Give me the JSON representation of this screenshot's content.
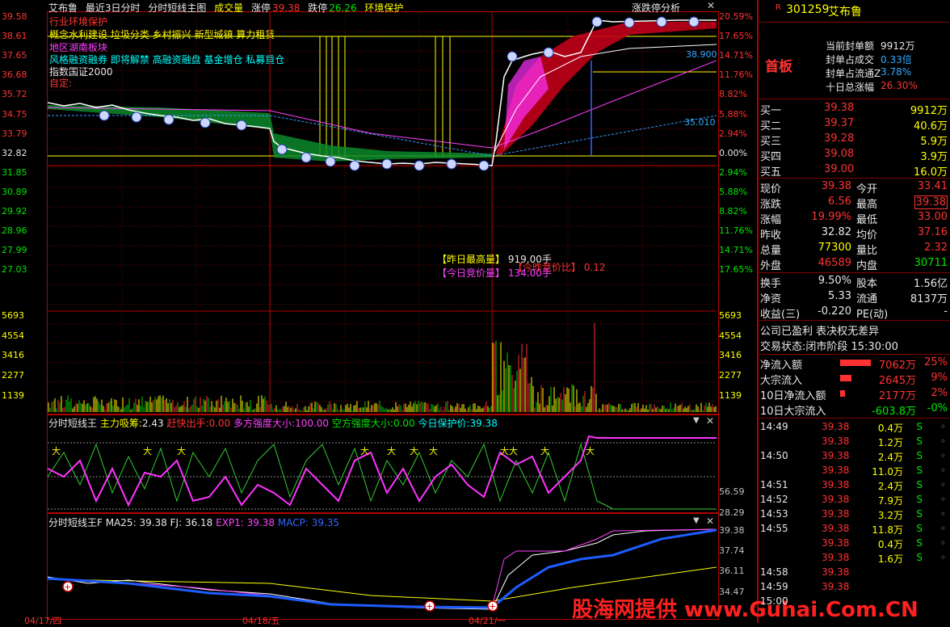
{
  "header": {
    "stock_name": "艾布鲁",
    "mode": "最近3日分时",
    "indicator": "分时短线主图",
    "volume_label": "成交量",
    "limit_up_label": "涨停",
    "limit_up_value": "39.38",
    "limit_down_label": "跌停",
    "limit_down_value": "26.26",
    "protect_label": "环境保护",
    "analysis_button": "涨跌停分析"
  },
  "concepts": {
    "line1": "行业环境保护",
    "line2": "概念水利建设 垃圾分类 乡村振兴 新型城镇 算力租赁",
    "line3": "地区湖南板块",
    "line4": "风格融资融券 即将解禁 高融资融盘 基金增仓 私募重仓",
    "line5": "指数国证2000",
    "line6": "自定:"
  },
  "price_axis_left": [
    "39.58",
    "38.61",
    "37.65",
    "36.68",
    "35.72",
    "34.75",
    "33.79",
    "32.82",
    "31.85",
    "30.89",
    "29.92",
    "28.96",
    "27.99",
    "27.03"
  ],
  "price_axis_right": [
    "20.59%",
    "17.65%",
    "14.71%",
    "11.76%",
    "8.82%",
    "5.88%",
    "2.94%",
    "0.00%",
    "2.94%",
    "5.88%",
    "8.82%",
    "11.76%",
    "14.71%",
    "17.65%"
  ],
  "volume_axis": [
    "5693",
    "4554",
    "3416",
    "2277",
    "1139"
  ],
  "chart_labels": {
    "avg_line_label": "35.010",
    "level_label": "38.900",
    "yest_high_vol_label": "【昨日最高量】",
    "yest_high_vol_value": "919.00手",
    "today_auction_label": "【今日竞价量】",
    "today_auction_value": "134.00手",
    "auction_ratio_label": "【今昨竞价比】",
    "auction_ratio_value": "0.12"
  },
  "panel2": {
    "title": "分时短线王",
    "main_label": "主力吸筹:",
    "main_value": "2.43",
    "exit_label": "赶快出手:",
    "exit_value": "0.00",
    "bull_label": "多方强度大小:",
    "bull_value": "100.00",
    "bear_label": "空方强度大小:",
    "bear_value": "0.00",
    "protect_label": "今日保护价:",
    "protect_value": "39.38",
    "axis": [
      "56.59",
      "28.29"
    ]
  },
  "panel3": {
    "title": "分时短线王F",
    "ma_label": "MA25:",
    "ma_value": "39.38",
    "fj_label": "FJ:",
    "fj_value": "36.18",
    "exp_label": "EXP1:",
    "exp_value": "39.38",
    "macp_label": "MACP:",
    "macp_value": "39.35",
    "axis": [
      "39.38",
      "37.74",
      "36.11",
      "34.47"
    ]
  },
  "dates": [
    "04/17/四",
    "04/18/五",
    "04/21/一"
  ],
  "watermark": "股海网提供 www.Guhai.Com.CN",
  "right": {
    "code": "301259",
    "name": "艾布鲁",
    "badge": "R",
    "board": "首板",
    "seal_rows": [
      {
        "label": "当前封单额",
        "value": "9912万"
      },
      {
        "label": "封单占成交",
        "value": "0.33倍"
      },
      {
        "label": "封单占流通Z",
        "value": "3.78%"
      },
      {
        "label": "十日总涨幅",
        "value": "26.30%"
      }
    ],
    "bids": [
      {
        "label": "买一",
        "price": "39.38",
        "vol": "9912万"
      },
      {
        "label": "买二",
        "price": "39.37",
        "vol": "40.6万"
      },
      {
        "label": "买三",
        "price": "39.28",
        "vol": "5.9万"
      },
      {
        "label": "买四",
        "price": "39.08",
        "vol": "3.9万"
      },
      {
        "label": "买五",
        "price": "39.00",
        "vol": "16.0万"
      }
    ],
    "quote": [
      {
        "l1": "现价",
        "v1": "39.38",
        "l2": "今开",
        "v2": "33.41"
      },
      {
        "l1": "涨跌",
        "v1": "6.56",
        "l2": "最高",
        "v2": "39.38"
      },
      {
        "l1": "涨幅",
        "v1": "19.99%",
        "l2": "最低",
        "v2": "33.00"
      },
      {
        "l1": "昨收",
        "v1": "32.82",
        "l2": "均价",
        "v2": "37.16"
      },
      {
        "l1": "总量",
        "v1": "77300",
        "l2": "量比",
        "v2": "2.32"
      },
      {
        "l1": "外盘",
        "v1": "46589",
        "l2": "内盘",
        "v2": "30711"
      }
    ],
    "fin": [
      {
        "l1": "换手",
        "v1": "9.50%",
        "l2": "股本",
        "v2": "1.56亿"
      },
      {
        "l1": "净资",
        "v1": "5.33",
        "l2": "流通",
        "v2": "8137万"
      },
      {
        "l1": "收益(三)",
        "v1": "-0.220",
        "l2": "PE(动)",
        "v2": "-"
      }
    ],
    "notice": "公司已盈利 表决权无差异",
    "trade_status": "交易状态:闭市阶段 15:30:00",
    "flows": [
      {
        "label": "净流入额",
        "value": "7062万",
        "pct": "25%"
      },
      {
        "label": "大宗流入",
        "value": "2645万",
        "pct": "9%"
      },
      {
        "label": "10日净流入额",
        "value": "2177万",
        "pct": "2%"
      },
      {
        "label": "10日大宗流入",
        "value": "-603.8万",
        "pct": "-0%"
      }
    ],
    "ticks": [
      {
        "time": "14:49",
        "price": "39.38",
        "vol": "0.4万",
        "side": "S"
      },
      {
        "time": "",
        "price": "39.38",
        "vol": "1.2万",
        "side": "S"
      },
      {
        "time": "14:50",
        "price": "39.38",
        "vol": "2.4万",
        "side": "S"
      },
      {
        "time": "",
        "price": "39.38",
        "vol": "11.0万",
        "side": "S"
      },
      {
        "time": "14:51",
        "price": "39.38",
        "vol": "2.4万",
        "side": "S"
      },
      {
        "time": "14:52",
        "price": "39.38",
        "vol": "7.9万",
        "side": "S"
      },
      {
        "time": "14:53",
        "price": "39.38",
        "vol": "3.2万",
        "side": "S"
      },
      {
        "time": "14:55",
        "price": "39.38",
        "vol": "11.8万",
        "side": "S"
      },
      {
        "time": "",
        "price": "39.38",
        "vol": "0.4万",
        "side": "S"
      },
      {
        "time": "",
        "price": "39.38",
        "vol": "1.6万",
        "side": "S"
      },
      {
        "time": "14:58",
        "price": "39.38",
        "vol": "",
        "side": ""
      },
      {
        "time": "14:59",
        "price": "39.38",
        "vol": "",
        "side": ""
      },
      {
        "time": "15:00",
        "price": "",
        "vol": "",
        "side": ""
      }
    ]
  }
}
